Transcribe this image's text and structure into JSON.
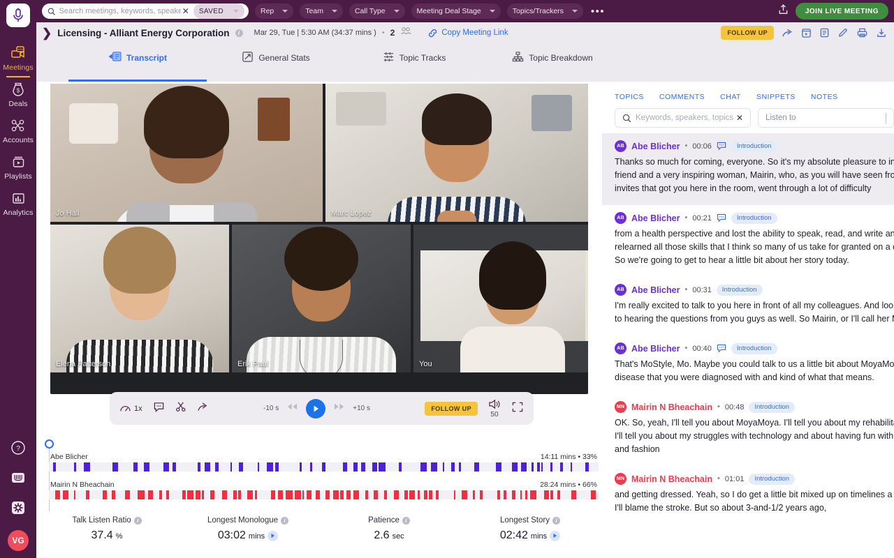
{
  "brand": {
    "accent_purple": "#4b1b45",
    "accent_blue": "#2f6df6",
    "accent_yellow": "#f6c33d",
    "green": "#3f8d3f"
  },
  "rail": {
    "logo_icon": "microphone-logo-icon",
    "items": [
      {
        "label": "Meetings",
        "icon": "meetings-video-icon",
        "active": true
      },
      {
        "label": "Deals",
        "icon": "money-bag-icon",
        "active": false
      },
      {
        "label": "Accounts",
        "icon": "network-nodes-icon",
        "active": false
      },
      {
        "label": "Playlists",
        "icon": "playlist-video-icon",
        "active": false
      },
      {
        "label": "Analytics",
        "icon": "bar-chart-icon",
        "active": false
      }
    ],
    "bottom": [
      {
        "name": "help-icon",
        "label": "?"
      },
      {
        "name": "library-icon",
        "label": ""
      },
      {
        "name": "settings-gear-icon",
        "label": ""
      }
    ],
    "avatar_initials": "VG"
  },
  "topbar": {
    "search_placeholder": "Search meetings, keywords, speakers, topics",
    "search_value": "",
    "clear_label": "✕",
    "saved_label": "SAVED",
    "filters": [
      {
        "label": "Rep"
      },
      {
        "label": "Team"
      },
      {
        "label": "Call Type"
      },
      {
        "label": "Meeting Deal Stage"
      },
      {
        "label": "Topics/Trackers"
      }
    ],
    "more_label": "•••",
    "share_icon": "upload-share-icon",
    "join_label": "JOIN LIVE MEETING"
  },
  "meeting_header": {
    "expand_icon": "chevron-right-icon",
    "title": "Licensing - Alliant Energy Corporation",
    "info_icon": "info-icon",
    "date": "Mar 29, Tue | 5:30 AM (34:37 mins )",
    "separator": "•",
    "participant_count": "2",
    "participants_icon": "people-icon",
    "copy_link_label": "Copy Meeting Link",
    "copy_link_icon": "link-icon",
    "follow_up_label": "FOLLOW UP",
    "actions": [
      {
        "name": "share-icon"
      },
      {
        "name": "video-clip-icon"
      },
      {
        "name": "notes-icon"
      },
      {
        "name": "edit-pencil-icon"
      },
      {
        "name": "print-icon"
      },
      {
        "name": "download-icon"
      }
    ]
  },
  "tabs": [
    {
      "label": "Transcript",
      "icon": "transcript-icon",
      "active": true
    },
    {
      "label": "General Stats",
      "icon": "trend-up-icon",
      "active": false
    },
    {
      "label": "Topic Tracks",
      "icon": "topic-tracks-icon",
      "active": false
    },
    {
      "label": "Topic Breakdown",
      "icon": "hierarchy-icon",
      "active": false
    }
  ],
  "video_grid": {
    "tiles": [
      {
        "name": "Jo Hall",
        "speaking": true
      },
      {
        "name": "Marc Lopez",
        "speaking": false
      },
      {
        "name": "Elena Patterson",
        "speaking": false
      },
      {
        "name": "Erik Paul",
        "speaking": false
      },
      {
        "name": "You",
        "speaking": false
      }
    ]
  },
  "player": {
    "speed_icon": "speedometer-icon",
    "speed_label": "1x",
    "comment_icon": "comment-icon",
    "scissors_icon": "scissors-icon",
    "share_icon": "share-arrow-icon",
    "rewind_label": "-10 s",
    "forward_label": "+10 s",
    "play_icon": "play-icon",
    "follow_up_label": "FOLLOW UP",
    "volume_icon": "volume-icon",
    "volume_value": "50",
    "fullscreen_icon": "expand-icon"
  },
  "timeline": {
    "playhead_icon": "playhead-handle-icon",
    "rows": [
      {
        "name": "Abe Blicher",
        "duration": "14:11 mins",
        "separator": "•",
        "percent": "33%",
        "color": "#4e22d4"
      },
      {
        "name": "Mairin N Bheachain",
        "duration": "28:24 mins",
        "separator": "•",
        "percent": "66%",
        "color": "#f03040"
      }
    ]
  },
  "metrics": [
    {
      "label": "Talk Listen Ratio",
      "value": "37.4",
      "unit": "%",
      "has_play": false
    },
    {
      "label": "Longest Monologue",
      "value": "03:02",
      "unit": "mins",
      "has_play": true
    },
    {
      "label": "Patience",
      "value": "2.6",
      "unit": "sec",
      "has_play": false
    },
    {
      "label": "Longest Story",
      "value": "02:42",
      "unit": "mins",
      "has_play": true
    }
  ],
  "right_panel": {
    "tabs": [
      {
        "label": "TOPICS"
      },
      {
        "label": "COMMENTS"
      },
      {
        "label": "CHAT"
      },
      {
        "label": "SNIPPETS"
      },
      {
        "label": "NOTES"
      }
    ],
    "search_placeholder": "Keywords, speakers, topics",
    "search_value": "",
    "clear_label": "✕",
    "listen_placeholder": "Listen to",
    "utterances": [
      {
        "initials": "AB",
        "speaker": "Abe Blicher",
        "color": "#6d2fd6",
        "timestamp": "00:06",
        "has_comment_icon": true,
        "topic": "Introduction",
        "highlight": true,
        "lines": [
          "Thanks so much for coming, everyone. So it's my absolute pleasure to introduce my",
          "friend and a very inspiring woman, Mairin, who, as you will have seen from the",
          "invites that got you here in the room, went through a lot of difficulty"
        ]
      },
      {
        "initials": "AB",
        "speaker": "Abe Blicher",
        "color": "#6d2fd6",
        "timestamp": "00:21",
        "has_comment_icon": true,
        "topic": "Introduction",
        "highlight": false,
        "lines": [
          "from a health perspective and lost the ability to speak, read, and write and",
          "relearned all those skills that I think so many of us take for granted on a daily basis.",
          "So we're going to get to hear a little bit about her story today."
        ]
      },
      {
        "initials": "AB",
        "speaker": "Abe Blicher",
        "color": "#6d2fd6",
        "timestamp": "00:31",
        "has_comment_icon": false,
        "topic": "Introduction",
        "highlight": false,
        "lines": [
          "I'm really excited to talk to you here in front of all my colleagues. And look forward",
          "to hearing the questions from you guys as well. So Mairin, or I'll call her Mo."
        ]
      },
      {
        "initials": "AB",
        "speaker": "Abe Blicher",
        "color": "#6d2fd6",
        "timestamp": "00:40",
        "has_comment_icon": true,
        "topic": "Introduction",
        "highlight": false,
        "lines": [
          "That's MoStyle, Mo. Maybe you could talk to us a little bit about MoyaMoya, the",
          "disease that you were diagnosed with and kind of what that means."
        ]
      },
      {
        "initials": "MN",
        "speaker": "Mairin N Bheachain",
        "color": "#ef3b4e",
        "timestamp": "00:48",
        "has_comment_icon": false,
        "topic": "Introduction",
        "highlight": false,
        "lines": [
          "OK. So, yeah, I'll tell you about MoyaMoya. I'll tell you about my rehabilitation. And",
          "I'll tell you about my struggles with technology and about having fun with style",
          "and fashion"
        ]
      },
      {
        "initials": "MN",
        "speaker": "Mairin N Bheachain",
        "color": "#ef3b4e",
        "timestamp": "01:01",
        "has_comment_icon": false,
        "topic": "Introduction",
        "highlight": false,
        "lines": [
          "and getting dressed. Yeah, so I do get a little bit mixed up on timelines a little bit.",
          "I'll blame the stroke. But so about 3-and-1/2 years ago,"
        ]
      }
    ]
  }
}
